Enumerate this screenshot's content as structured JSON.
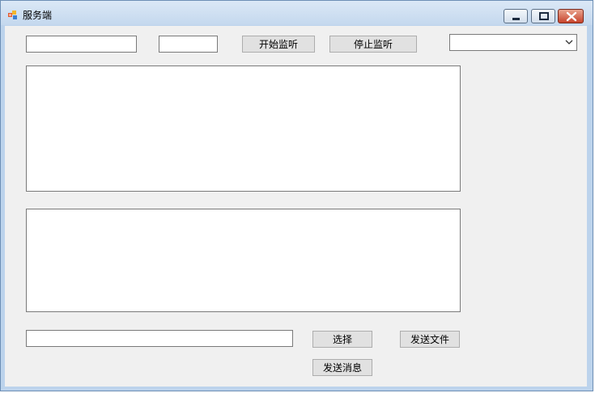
{
  "window": {
    "title": "服务端",
    "controls": {
      "minimize_icon": "minimize-icon",
      "maximize_icon": "restore-icon",
      "close_icon": "close-icon"
    }
  },
  "connection": {
    "ip_value": "",
    "port_value": "",
    "start_listen_label": "开始监听",
    "stop_listen_label": "停止监听",
    "client_select_value": ""
  },
  "log_area": {
    "value": ""
  },
  "message_area": {
    "value": ""
  },
  "file": {
    "path_value": "",
    "choose_label": "选择",
    "send_file_label": "发送文件"
  },
  "send_message_label": "发送消息",
  "colors": {
    "client_bg": "#f0f0f0",
    "title_gradient_top": "#dbe8f6",
    "close_button": "#c7432b"
  }
}
